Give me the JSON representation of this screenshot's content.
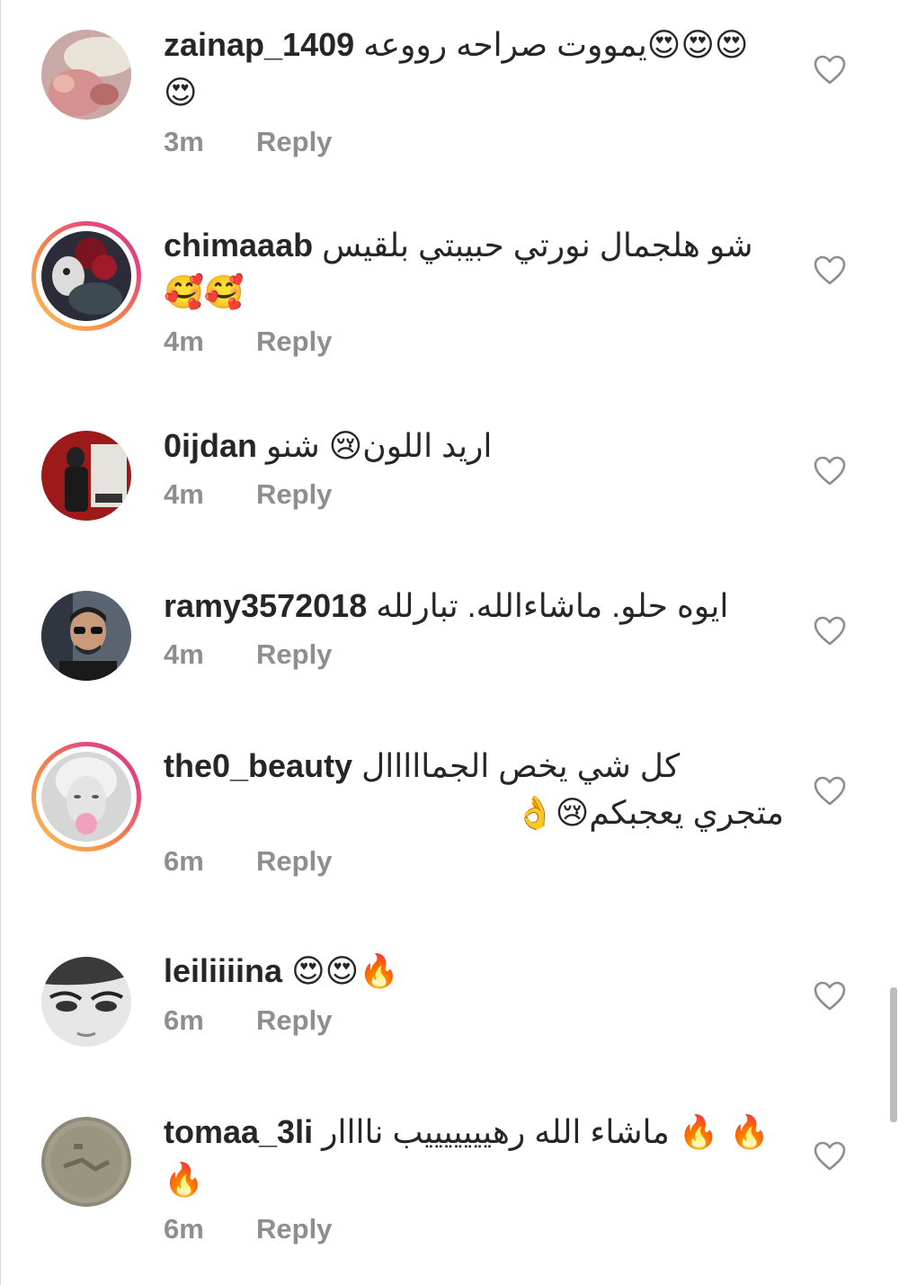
{
  "comments": [
    {
      "username": "zainap_1409",
      "text": "يمووت صراحه رووعه",
      "emojis_line1": "😍😍😍",
      "line2": "😍",
      "time": "3m",
      "reply": "Reply",
      "story_ring": false
    },
    {
      "username": "chimaaab",
      "text": "شو هلجمال نورتي حبيبتي بلقيس",
      "emojis_line1": "",
      "line2": "🥰🥰",
      "time": "4m",
      "reply": "Reply",
      "story_ring": true
    },
    {
      "username": "0ijdan",
      "text": "اريد اللون😢 شنو",
      "emojis_line1": "",
      "line2": "",
      "time": "4m",
      "reply": "Reply",
      "story_ring": false
    },
    {
      "username": "ramy3572018",
      "text": "ايوه حلو.  ماشاءالله.  تبارلله",
      "emojis_line1": "",
      "line2": "",
      "time": "4m",
      "reply": "Reply",
      "story_ring": false
    },
    {
      "username": "the0_beauty",
      "text": "كل شي يخص الجمااااال",
      "emojis_line1": "",
      "line2": "متجري يعجبكم😢👌",
      "time": "6m",
      "reply": "Reply",
      "story_ring": true
    },
    {
      "username": "leiliiiina",
      "text": "",
      "emojis_line1": "😍😍🔥",
      "line2": "",
      "time": "6m",
      "reply": "Reply",
      "story_ring": false
    },
    {
      "username": "tomaa_3li",
      "text": "ماشاء الله رهيييييييب ناااار",
      "emojis_line1": "🔥 🔥",
      "line2": "🔥",
      "time": "6m",
      "reply": "Reply",
      "story_ring": false
    }
  ],
  "icons": {
    "like": "heart-outline-icon"
  },
  "colors": {
    "username": "#262626",
    "meta": "#8e8e8e",
    "story_ring_start": "#f9c35a",
    "story_ring_end": "#c7368a"
  }
}
